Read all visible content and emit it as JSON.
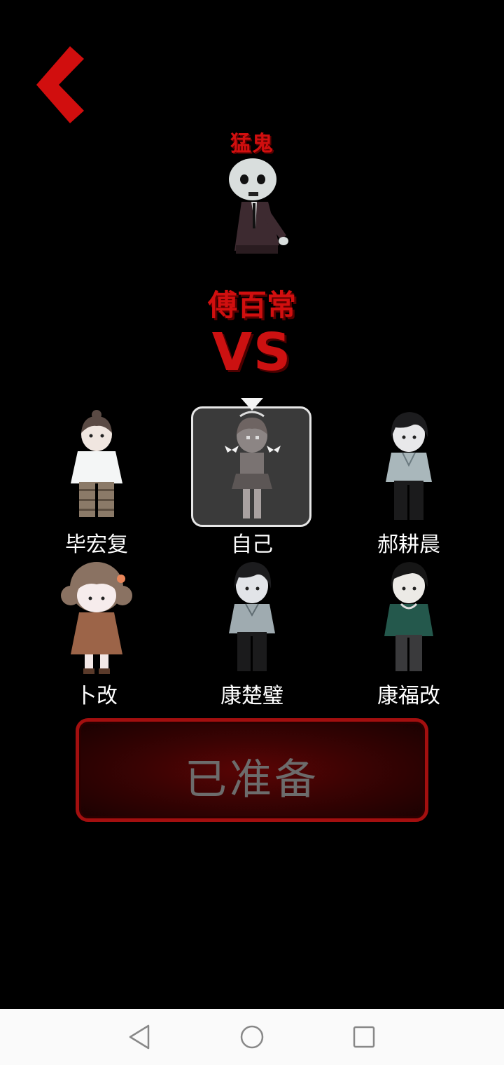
{
  "header": {
    "back_icon": "chevron-left-icon",
    "ghost_label": "猛鬼",
    "boss_name": "傅百常",
    "vs_text": "VS"
  },
  "players": [
    {
      "name": "毕宏复",
      "selected": false
    },
    {
      "name": "自己",
      "selected": true
    },
    {
      "name": "郝耕晨",
      "selected": false
    },
    {
      "name": "卜改",
      "selected": false
    },
    {
      "name": "康楚璧",
      "selected": false
    },
    {
      "name": "康福改",
      "selected": false
    }
  ],
  "ready_button": {
    "label": "已准备"
  },
  "system_nav": {
    "back_icon": "triangle-back-icon",
    "home_icon": "circle-home-icon",
    "recents_icon": "square-recents-icon"
  },
  "colors": {
    "accent_red": "#d10f0f",
    "background": "#000000",
    "button_border": "#a30f0f",
    "button_label": "#6c6c6c"
  }
}
